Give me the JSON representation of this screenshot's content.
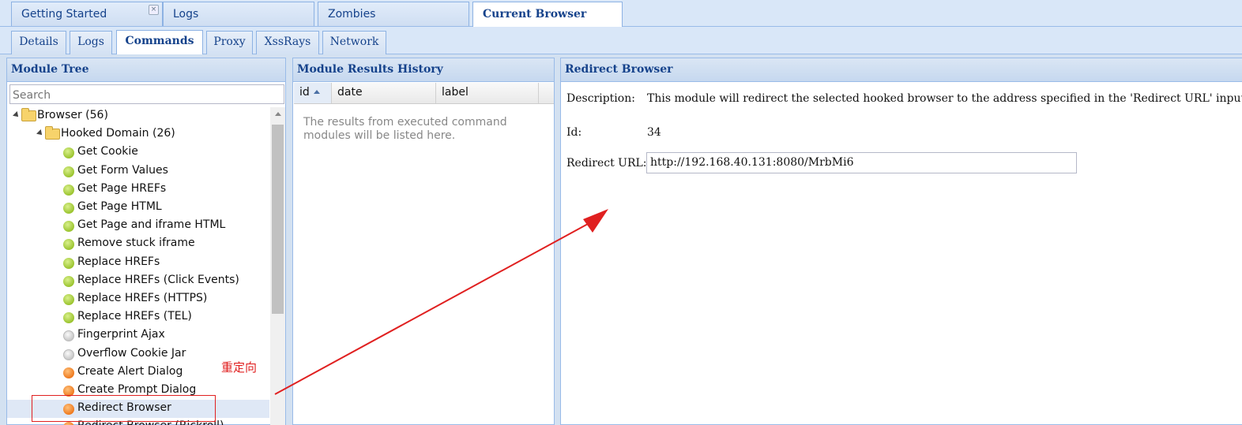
{
  "top_tabs": [
    {
      "label": "Getting Started",
      "closable": true,
      "active": false
    },
    {
      "label": "Logs",
      "closable": false,
      "active": false
    },
    {
      "label": "Zombies",
      "closable": false,
      "active": false
    },
    {
      "label": "Current Browser",
      "closable": false,
      "active": true
    }
  ],
  "sub_tabs": [
    {
      "label": "Details",
      "active": false
    },
    {
      "label": "Logs",
      "active": false
    },
    {
      "label": "Commands",
      "active": true
    },
    {
      "label": "Proxy",
      "active": false
    },
    {
      "label": "XssRays",
      "active": false
    },
    {
      "label": "Network",
      "active": false
    }
  ],
  "module_tree": {
    "title": "Module Tree",
    "search_placeholder": "Search",
    "items": [
      {
        "label": "Browser (56)",
        "type": "folder"
      },
      {
        "label": "Hooked Domain (26)",
        "type": "folder"
      },
      {
        "label": "Get Cookie",
        "status": "green"
      },
      {
        "label": "Get Form Values",
        "status": "green"
      },
      {
        "label": "Get Page HREFs",
        "status": "green"
      },
      {
        "label": "Get Page HTML",
        "status": "green"
      },
      {
        "label": "Get Page and iframe HTML",
        "status": "green"
      },
      {
        "label": "Remove stuck iframe",
        "status": "green"
      },
      {
        "label": "Replace HREFs",
        "status": "green"
      },
      {
        "label": "Replace HREFs (Click Events)",
        "status": "green"
      },
      {
        "label": "Replace HREFs (HTTPS)",
        "status": "green"
      },
      {
        "label": "Replace HREFs (TEL)",
        "status": "green"
      },
      {
        "label": "Fingerprint Ajax",
        "status": "grey"
      },
      {
        "label": "Overflow Cookie Jar",
        "status": "grey"
      },
      {
        "label": "Create Alert Dialog",
        "status": "orange"
      },
      {
        "label": "Create Prompt Dialog",
        "status": "orange"
      },
      {
        "label": "Redirect Browser",
        "status": "orange",
        "selected": true
      },
      {
        "label": "Redirect Browser (Rickroll)",
        "status": "orange"
      }
    ]
  },
  "annotation": {
    "text": "重定向",
    "color": "#e02020"
  },
  "results": {
    "title": "Module Results History",
    "columns": [
      "id",
      "date",
      "label"
    ],
    "empty_text": "The results from executed command modules will be listed here."
  },
  "redirect": {
    "title": "Redirect Browser",
    "description_label": "Description:",
    "description": "This module will redirect the selected hooked browser to the address specified in the 'Redirect URL' input.",
    "id_label": "Id:",
    "id": "34",
    "url_label": "Redirect URL:",
    "url": "http://192.168.40.131:8080/MrbMi6"
  },
  "colors": {
    "header_text": "#15428b",
    "border": "#99bbe8",
    "annotation": "#e02020"
  }
}
